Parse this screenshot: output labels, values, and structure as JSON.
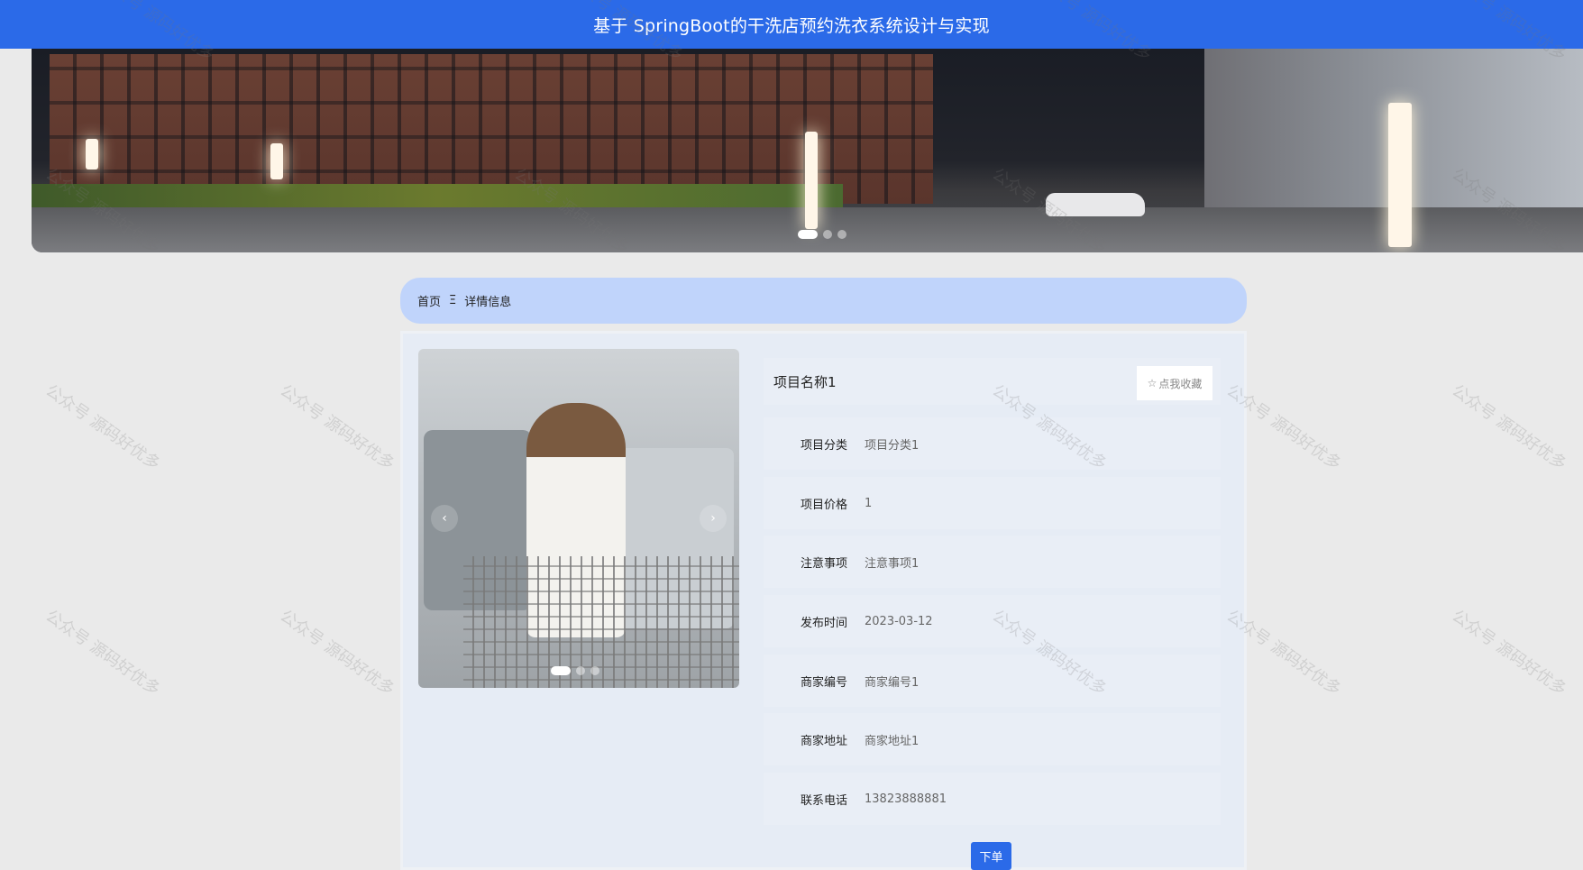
{
  "header": {
    "title": "基于 SpringBoot的干洗店预约洗衣系统设计与实现"
  },
  "breadcrumb": {
    "home": "首页",
    "separator": "Ξ",
    "current": "详情信息"
  },
  "detail": {
    "name": "项目名称1",
    "favorite_icon": "☆",
    "favorite_label": "点我收藏",
    "fields": [
      {
        "label": "项目分类",
        "value": "项目分类1"
      },
      {
        "label": "项目价格",
        "value": "1"
      },
      {
        "label": "注意事项",
        "value": "注意事项1"
      },
      {
        "label": "发布时间",
        "value": "2023-03-12"
      },
      {
        "label": "商家编号",
        "value": "商家编号1"
      },
      {
        "label": "商家地址",
        "value": "商家地址1"
      },
      {
        "label": "联系电话",
        "value": "13823888881"
      }
    ],
    "order_button": "下单"
  },
  "carousel": {
    "prev_icon": "‹",
    "next_icon": "›"
  },
  "watermark_text": "公众号 源码好优多",
  "colors": {
    "accent": "#2b6ae8",
    "breadcrumb_bg": "#c0d4fb"
  }
}
